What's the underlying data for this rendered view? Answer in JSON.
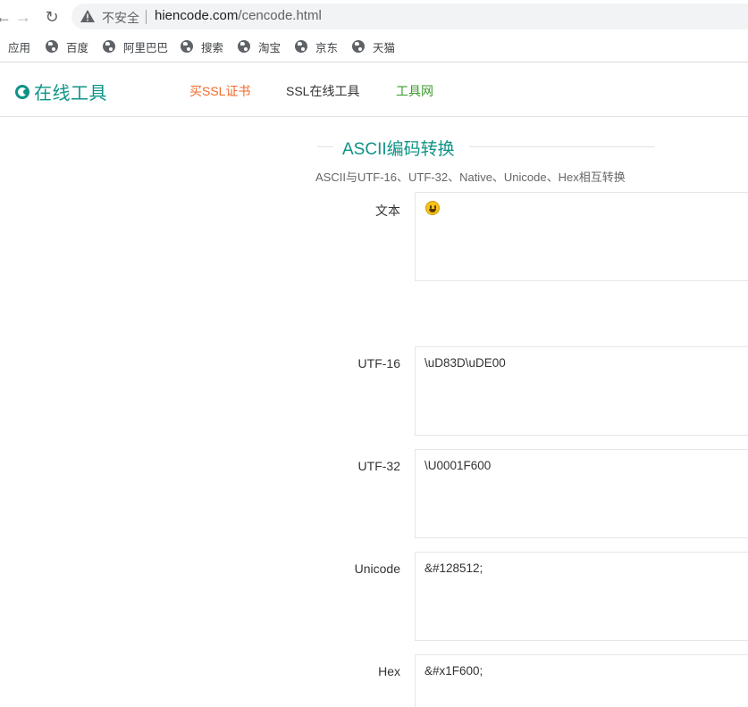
{
  "browser": {
    "security_label": "不安全",
    "url_host": "hiencode.com",
    "url_path": "/cencode.html",
    "bookmarks": [
      {
        "label": "应用",
        "icon": "apps-icon"
      },
      {
        "label": "百度",
        "icon": "globe-icon"
      },
      {
        "label": "阿里巴巴",
        "icon": "globe-icon"
      },
      {
        "label": "搜索",
        "icon": "globe-icon"
      },
      {
        "label": "淘宝",
        "icon": "globe-icon"
      },
      {
        "label": "京东",
        "icon": "globe-icon"
      },
      {
        "label": "天猫",
        "icon": "globe-icon"
      }
    ]
  },
  "header": {
    "logo_text": "在线工具",
    "nav": [
      {
        "label": "买SSL证书",
        "color": "#f06a2a"
      },
      {
        "label": "SSL在线工具",
        "color": "#333333"
      },
      {
        "label": "工具网",
        "color": "#3a9a2a"
      }
    ]
  },
  "main": {
    "title": "ASCII编码转换",
    "subtitle": "ASCII与UTF-16、UTF-32、Native、Unicode、Hex相互转换",
    "fields": [
      {
        "label": "文本",
        "value": "😀",
        "icon": "grinning-face-emoji"
      },
      {
        "label": "UTF-16",
        "value": "\\uD83D\\uDE00"
      },
      {
        "label": "UTF-32",
        "value": "\\U0001F600"
      },
      {
        "label": "Unicode",
        "value": "&#128512;"
      },
      {
        "label": "Hex",
        "value": "&#x1F600;"
      }
    ]
  },
  "colors": {
    "brand": "#0e9486",
    "nav_ssl": "#f06a2a",
    "nav_tools": "#3a9a2a"
  }
}
